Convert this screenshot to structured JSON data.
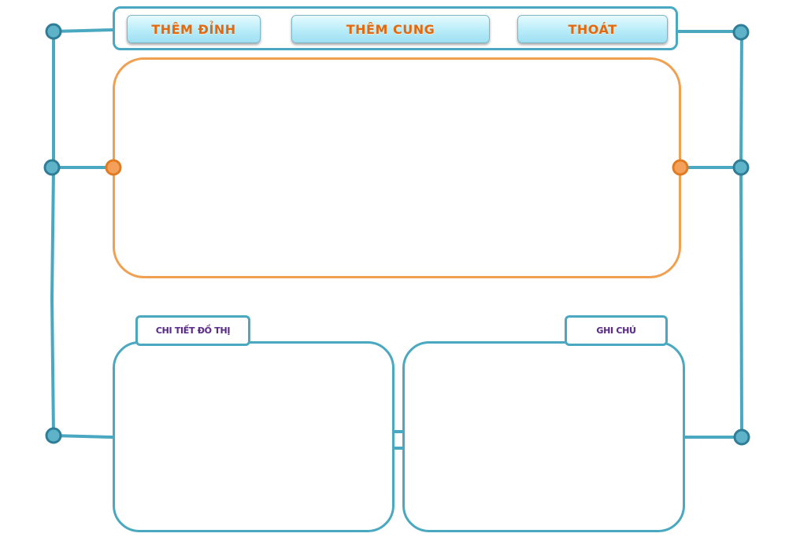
{
  "toolbar": {
    "add_vertex_label": "THÊM ĐỈNH",
    "add_edge_label": "THÊM CUNG",
    "exit_label": "THOÁT"
  },
  "panels": {
    "graph_details_title": "CHI TIẾT ĐỒ THỊ",
    "notes_title": "GHI CHÚ"
  },
  "colors": {
    "frame_blue": "#4aa8c0",
    "node_blue": "#3d8fab",
    "canvas_orange": "#f0a050",
    "node_orange": "#f08a30",
    "button_text": "#e06a12",
    "panel_title_text": "#5a2e86"
  }
}
